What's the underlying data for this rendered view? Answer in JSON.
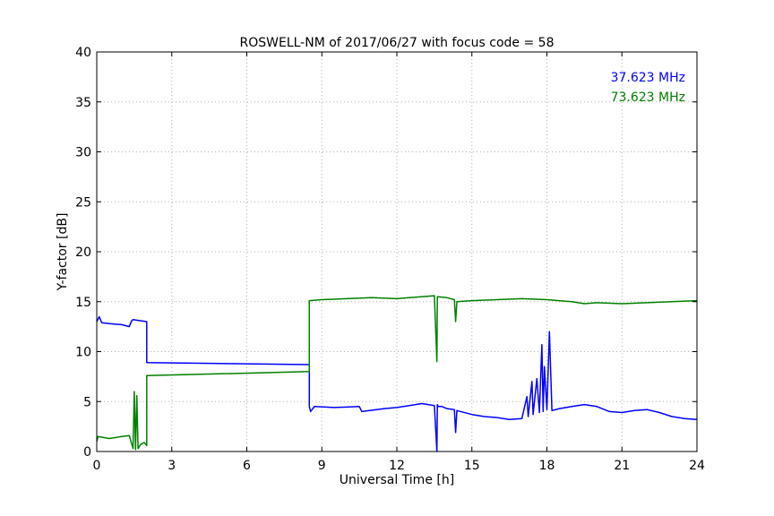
{
  "chart_data": {
    "type": "line",
    "title": "ROSWELL-NM of 2017/06/27 with focus code = 58",
    "xlabel": "Universal Time [h]",
    "ylabel": "Y-factor [dB]",
    "xlim": [
      0,
      24
    ],
    "ylim": [
      0,
      40
    ],
    "xticks": [
      0,
      3,
      6,
      9,
      12,
      15,
      18,
      21,
      24
    ],
    "yticks": [
      0,
      5,
      10,
      15,
      20,
      25,
      30,
      35,
      40
    ],
    "grid": true,
    "legend": "top-right",
    "series": [
      {
        "name": "37.623 MHz",
        "color": "#0000ff",
        "x": [
          0,
          0.1,
          0.2,
          0.5,
          1.0,
          1.3,
          1.4,
          1.45,
          1.7,
          2.0,
          2.0,
          8.5,
          8.5,
          8.55,
          8.7,
          9.5,
          10.5,
          10.6,
          11.5,
          12.0,
          12.5,
          13.0,
          13.5,
          13.6,
          13.62,
          13.65,
          13.8,
          14.0,
          14.3,
          14.35,
          14.4,
          15.0,
          15.5,
          16.0,
          16.5,
          17.0,
          17.2,
          17.25,
          17.4,
          17.45,
          17.6,
          17.7,
          17.8,
          17.85,
          17.9,
          18.0,
          18.1,
          18.2,
          18.5,
          19.0,
          19.5,
          20.0,
          20.5,
          21.0,
          21.5,
          22.0,
          22.5,
          23.0,
          23.5,
          24.0
        ],
        "y": [
          13.0,
          13.5,
          12.9,
          12.8,
          12.7,
          12.5,
          13.1,
          13.2,
          13.1,
          13.0,
          8.9,
          8.7,
          4.5,
          4.0,
          4.5,
          4.4,
          4.5,
          4.0,
          4.3,
          4.4,
          4.6,
          4.8,
          4.6,
          0.0,
          4.7,
          4.5,
          4.5,
          4.3,
          4.2,
          1.9,
          4.1,
          3.7,
          3.5,
          3.4,
          3.2,
          3.3,
          5.5,
          3.5,
          7.0,
          3.7,
          7.3,
          3.9,
          10.7,
          4.0,
          8.5,
          4.2,
          12.0,
          4.1,
          4.3,
          4.5,
          4.7,
          4.5,
          4.0,
          3.9,
          4.1,
          4.2,
          3.9,
          3.5,
          3.3,
          3.2
        ]
      },
      {
        "name": "73.623 MHz",
        "color": "#008000",
        "x": [
          0,
          0.05,
          0.5,
          1.0,
          1.3,
          1.45,
          1.5,
          1.55,
          1.6,
          1.65,
          1.75,
          1.9,
          2.0,
          2.0,
          8.5,
          8.5,
          9.0,
          10.0,
          11.0,
          12.0,
          12.5,
          13.0,
          13.5,
          13.6,
          13.62,
          13.65,
          14.0,
          14.3,
          14.35,
          14.4,
          15.0,
          16.0,
          17.0,
          18.0,
          19.0,
          19.5,
          20.0,
          21.0,
          22.0,
          23.0,
          24.0
        ],
        "y": [
          1.0,
          1.5,
          1.3,
          1.5,
          1.6,
          0.3,
          6.0,
          0.2,
          5.6,
          0.3,
          0.7,
          0.9,
          0.6,
          7.6,
          8.0,
          15.1,
          15.2,
          15.3,
          15.4,
          15.3,
          15.4,
          15.5,
          15.6,
          9.0,
          15.5,
          15.5,
          15.4,
          15.2,
          13.0,
          15.0,
          15.1,
          15.2,
          15.3,
          15.2,
          15.0,
          14.8,
          14.9,
          14.8,
          14.9,
          15.0,
          15.1
        ]
      }
    ]
  }
}
